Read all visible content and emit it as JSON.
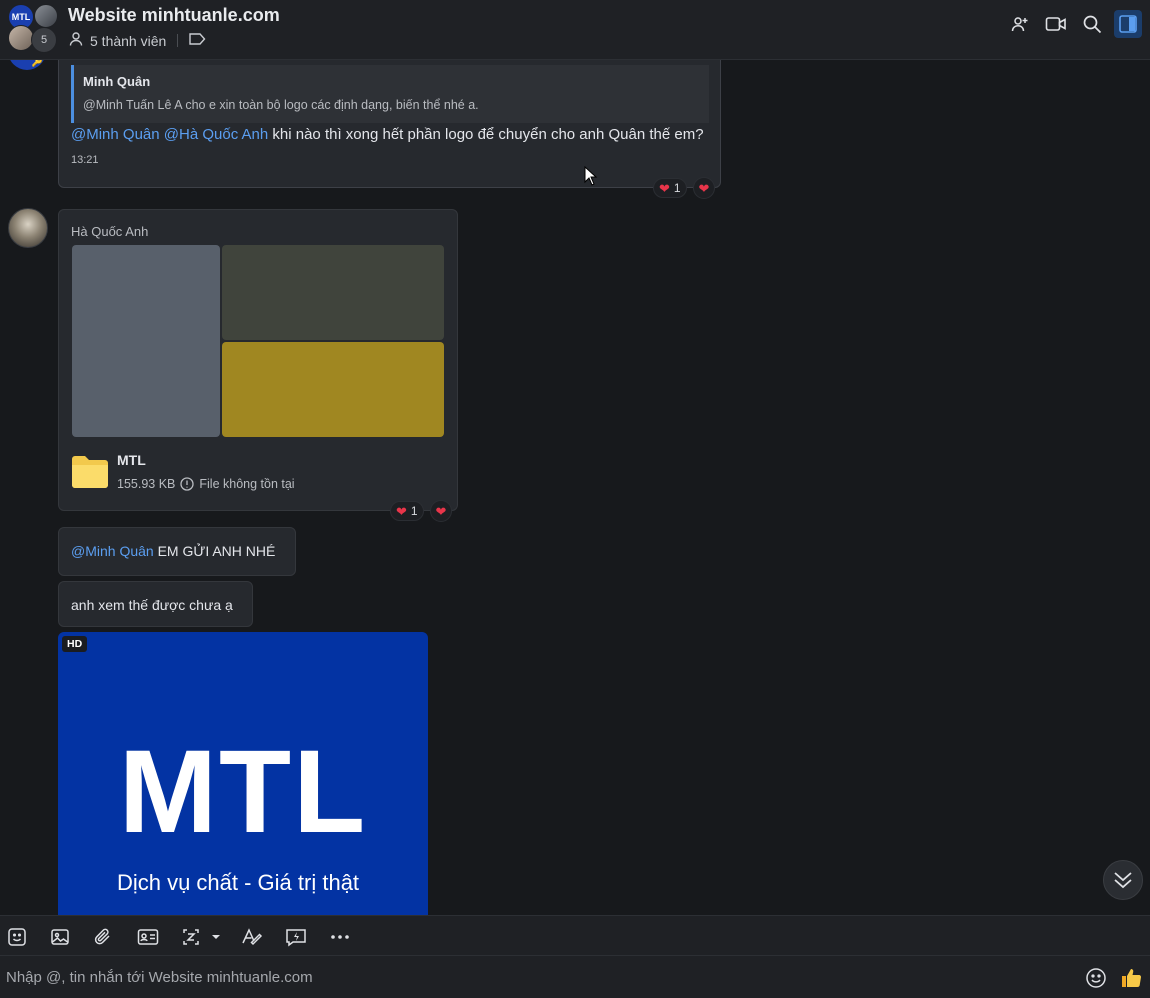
{
  "header": {
    "title": "Website minhtuanle.com",
    "members": "5 thành viên",
    "group_avatar_text": "MTL",
    "member_count_badge": "5"
  },
  "messages": {
    "m1": {
      "quote_name": "Minh Quân",
      "quote_text": "@Minh Tuấn Lê A cho e xin toàn bộ logo các định dạng, biến thể nhé a.",
      "mention1": "@Minh Quân",
      "mention2": "@Hà Quốc Anh",
      "text": " khi nào thì xong hết phần logo để chuyển cho anh Quân thế em?",
      "time": "13:21",
      "reaction_count": "1"
    },
    "m2": {
      "sender": "Hà Quốc Anh",
      "file_name": "MTL",
      "file_size": "155.93 KB",
      "file_status": "File không tồn tại",
      "reaction_count": "1",
      "image_colors": [
        "#58606b",
        "#40443c",
        "#a08721"
      ]
    },
    "m3": {
      "mention": "@Minh Quân",
      "text": " EM GỬI ANH NHÉ"
    },
    "m4": {
      "text": "anh xem thế được chưa ạ"
    },
    "m5": {
      "badge": "HD",
      "logo_text": "MTL",
      "slogan": "Dịch vụ chất - Giá trị thật",
      "bg_color": "#0333a3"
    }
  },
  "composer": {
    "placeholder": "Nhập @, tin nhắn tới Website minhtuanle.com"
  },
  "colors": {
    "accent": "#5b9ef0",
    "heart": "#e8354a",
    "background": "#17191c"
  }
}
